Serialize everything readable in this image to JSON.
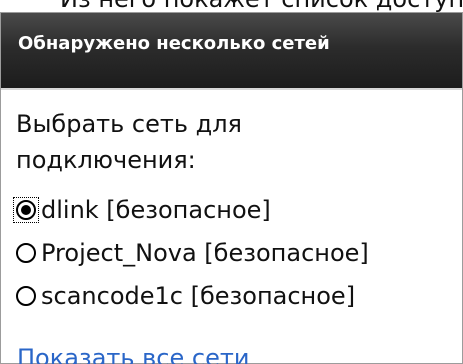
{
  "top_caption": "Из него покажет список доступ",
  "dialog": {
    "title": "Обнаружено несколько сетей",
    "prompt": "Выбрать сеть для подключения:",
    "networks": [
      {
        "label": "dlink [безопасное]",
        "selected": true
      },
      {
        "label": "Project_Nova [безопасное]",
        "selected": false
      },
      {
        "label": "scancode1c [безопасное]",
        "selected": false
      }
    ],
    "show_all_link": "Показать все сети"
  },
  "colors": {
    "header_bg": "#2c2c2c",
    "header_text": "#ffffff",
    "link": "#2a66c8",
    "text": "#111111"
  }
}
